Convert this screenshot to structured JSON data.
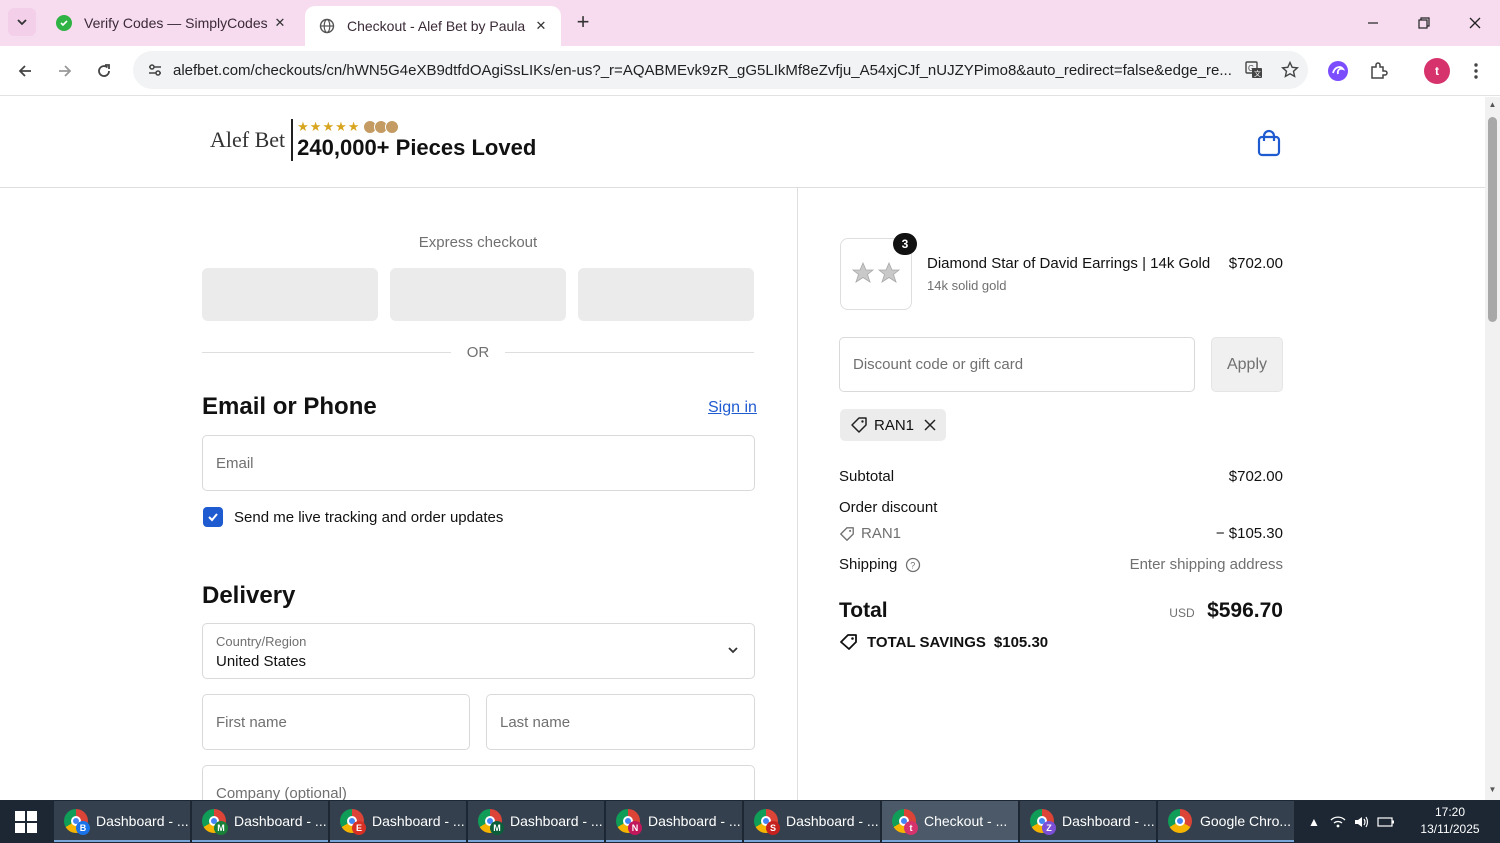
{
  "browser": {
    "tabs": [
      {
        "title": "Verify Codes — SimplyCodes",
        "active": false
      },
      {
        "title": "Checkout - Alef Bet by Paula",
        "active": true
      }
    ],
    "url": "alefbet.com/checkouts/cn/hWN5G4eXB9dtfdOAgiSsLIKs/en-us?_r=AQABMEvk9zR_gG5LIkMf8eZvfju_A54xjCJf_nUJZYPimo8&auto_redirect=false&edge_re...",
    "profile_initial": "t"
  },
  "header": {
    "brand": "Alef Bet",
    "stars": "★★★★★",
    "tagline": "240,000+ Pieces Loved"
  },
  "checkout": {
    "express_label": "Express checkout",
    "or_label": "OR",
    "contact_heading": "Email or Phone",
    "sign_in": "Sign in",
    "email_placeholder": "Email",
    "marketing_label": "Send me live tracking and order updates",
    "delivery_heading": "Delivery",
    "country_label": "Country/Region",
    "country_value": "United States",
    "first_name_placeholder": "First name",
    "last_name_placeholder": "Last name",
    "company_placeholder": "Company (optional)"
  },
  "summary": {
    "item": {
      "quantity": "3",
      "name": "Diamond Star of David Earrings | 14k Gold",
      "variant": "14k solid gold",
      "price": "$702.00"
    },
    "discount_placeholder": "Discount code or gift card",
    "apply_label": "Apply",
    "applied_code": "RAN1",
    "subtotal_label": "Subtotal",
    "subtotal_value": "$702.00",
    "order_discount_label": "Order discount",
    "discount_code": "RAN1",
    "discount_value": "− $105.30",
    "shipping_label": "Shipping",
    "shipping_value": "Enter shipping address",
    "total_label": "Total",
    "currency": "USD",
    "total_value": "$596.70",
    "savings_label": "TOTAL SAVINGS",
    "savings_value": "$105.30"
  },
  "taskbar": {
    "items": [
      {
        "label": "Dashboard - ...",
        "badge": "B",
        "badge_color": "#1a73e8",
        "active": false
      },
      {
        "label": "Dashboard - ...",
        "badge": "M",
        "badge_color": "#188038",
        "active": false
      },
      {
        "label": "Dashboard - ...",
        "badge": "E",
        "badge_color": "#d93025",
        "active": false
      },
      {
        "label": "Dashboard - ...",
        "badge": "M",
        "badge_color": "#0b5e3a",
        "active": false
      },
      {
        "label": "Dashboard - ...",
        "badge": "N",
        "badge_color": "#c2185b",
        "active": false
      },
      {
        "label": "Dashboard - ...",
        "badge": "S",
        "badge_color": "#c5221f",
        "active": false
      },
      {
        "label": "Checkout - ...",
        "badge": "t",
        "badge_color": "#d6336c",
        "active": true
      },
      {
        "label": "Dashboard - ...",
        "badge": "Z",
        "badge_color": "#7b4fd6",
        "active": false
      },
      {
        "label": "Google Chro...",
        "badge": "",
        "badge_color": "",
        "active": false
      }
    ],
    "time": "17:20",
    "date": "13/11/2025"
  },
  "colors": {
    "tabbar_bg": "#f7dcf0",
    "link_blue": "#1f5bd0",
    "taskbar_bg": "#1c2733"
  }
}
